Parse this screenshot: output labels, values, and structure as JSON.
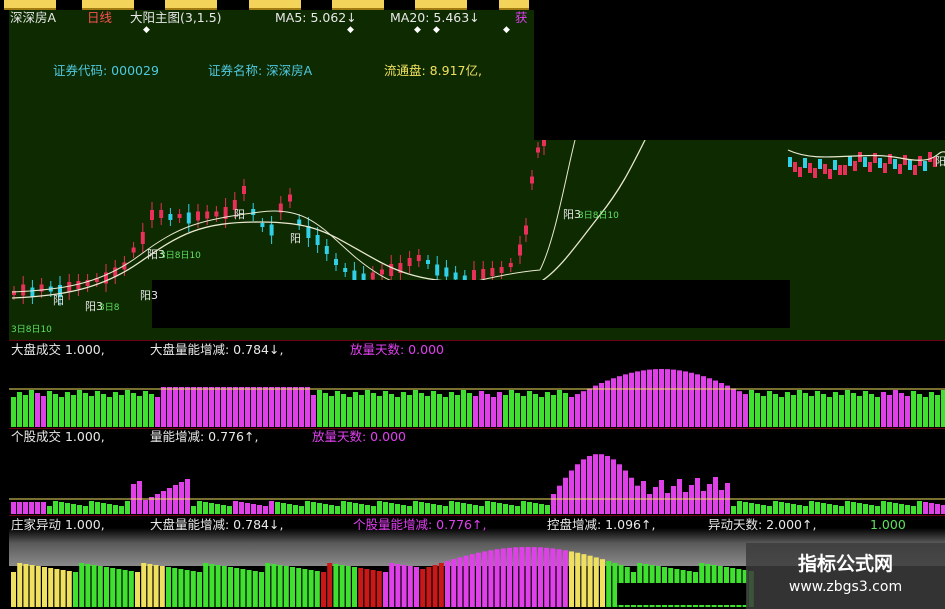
{
  "toolbar": {
    "buttons": [
      "",
      "",
      "",
      "",
      "",
      "",
      ""
    ]
  },
  "main_header": {
    "stock": "深深房A",
    "period": "日线",
    "indicator": "大阳主图(3,1.5)",
    "ma5": "MA5: 5.062↓",
    "ma20": "MA20: 5.463↓",
    "extra": "获"
  },
  "info_line": {
    "code": "证券代码: 000029",
    "name": "证券名称: 深深房A",
    "float": "流通盘: 8.917亿,"
  },
  "candle_labels": [
    "阳",
    "阳",
    "阳",
    "阳3",
    "阳3",
    "阳3",
    "阳3",
    "阳",
    "阳",
    "阳",
    "阳"
  ],
  "num_labels": [
    "3日8日10",
    "3日8日10",
    "3日8",
    "3日8日10"
  ],
  "panel2": {
    "p1": "大盘成交 1.000,",
    "p2": "大盘量能增减: 0.784↓,",
    "p3": "放量天数: 0.000"
  },
  "panel3": {
    "p1": "个股成交 1.000,",
    "p2": "量能增减: 0.776↑,",
    "p3": "放量天数: 0.000"
  },
  "panel4": {
    "p1": "庄家异动 1.000,",
    "p2": "大盘量能增减: 0.784↓,",
    "p3": "个股量能增减: 0.776↑,",
    "p4": "控盘增减: 1.096↑,",
    "p5": "异动天数: 2.000↑,",
    "p6": "1.000"
  },
  "watermark": {
    "title": "指标公式网",
    "url": "www.zbgs3.com"
  },
  "colors": {
    "up_candle": "#e8305a",
    "down_candle": "#30d0e8",
    "green_bar": "#40e030",
    "magenta_bar": "#e040e8",
    "yellow_bar": "#f0e060",
    "red_bar": "#c81818"
  }
}
